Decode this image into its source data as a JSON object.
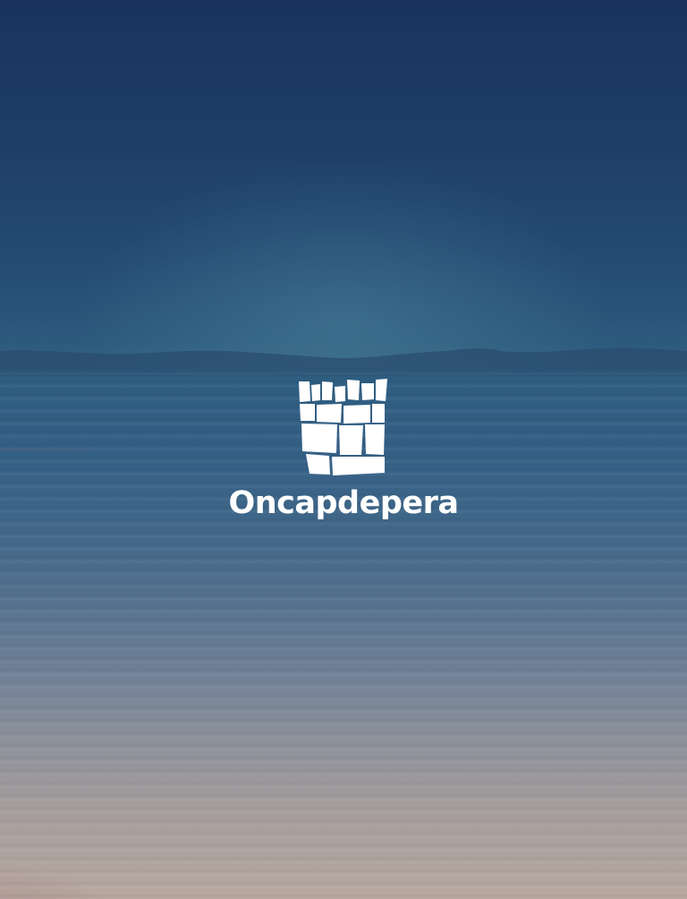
{
  "app": {
    "brand_name": "Oncapdepera",
    "logo_icon": "castle-tower-icon"
  },
  "colors": {
    "sky_top": "#1a3360",
    "horizon": "#33617f",
    "water_bottom": "#b7a89f",
    "logo": "#ffffff"
  }
}
